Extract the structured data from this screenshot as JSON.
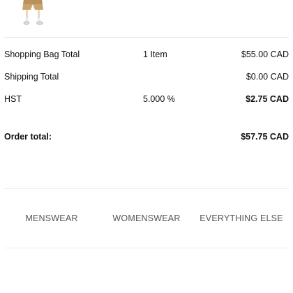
{
  "product": {
    "image_icon": "product-photo-shorts"
  },
  "summary": {
    "rows": [
      {
        "label": "Shopping Bag Total",
        "mid": "1 Item",
        "value": "$55.00 CAD"
      },
      {
        "label": "Shipping Total",
        "mid": "",
        "value": "$0.00 CAD"
      },
      {
        "label": "HST",
        "mid": "5.000 %",
        "value": "$2.75 CAD"
      }
    ],
    "order_total_label": "Order total:",
    "order_total_value": "$57.75 CAD"
  },
  "nav": {
    "items": [
      "MENSWEAR",
      "WOMENSWEAR",
      "EVERYTHING ELSE"
    ]
  },
  "colors": {
    "text": "#111111",
    "nav_text": "#555555",
    "divider": "#e6e6e6",
    "background": "#ffffff"
  }
}
